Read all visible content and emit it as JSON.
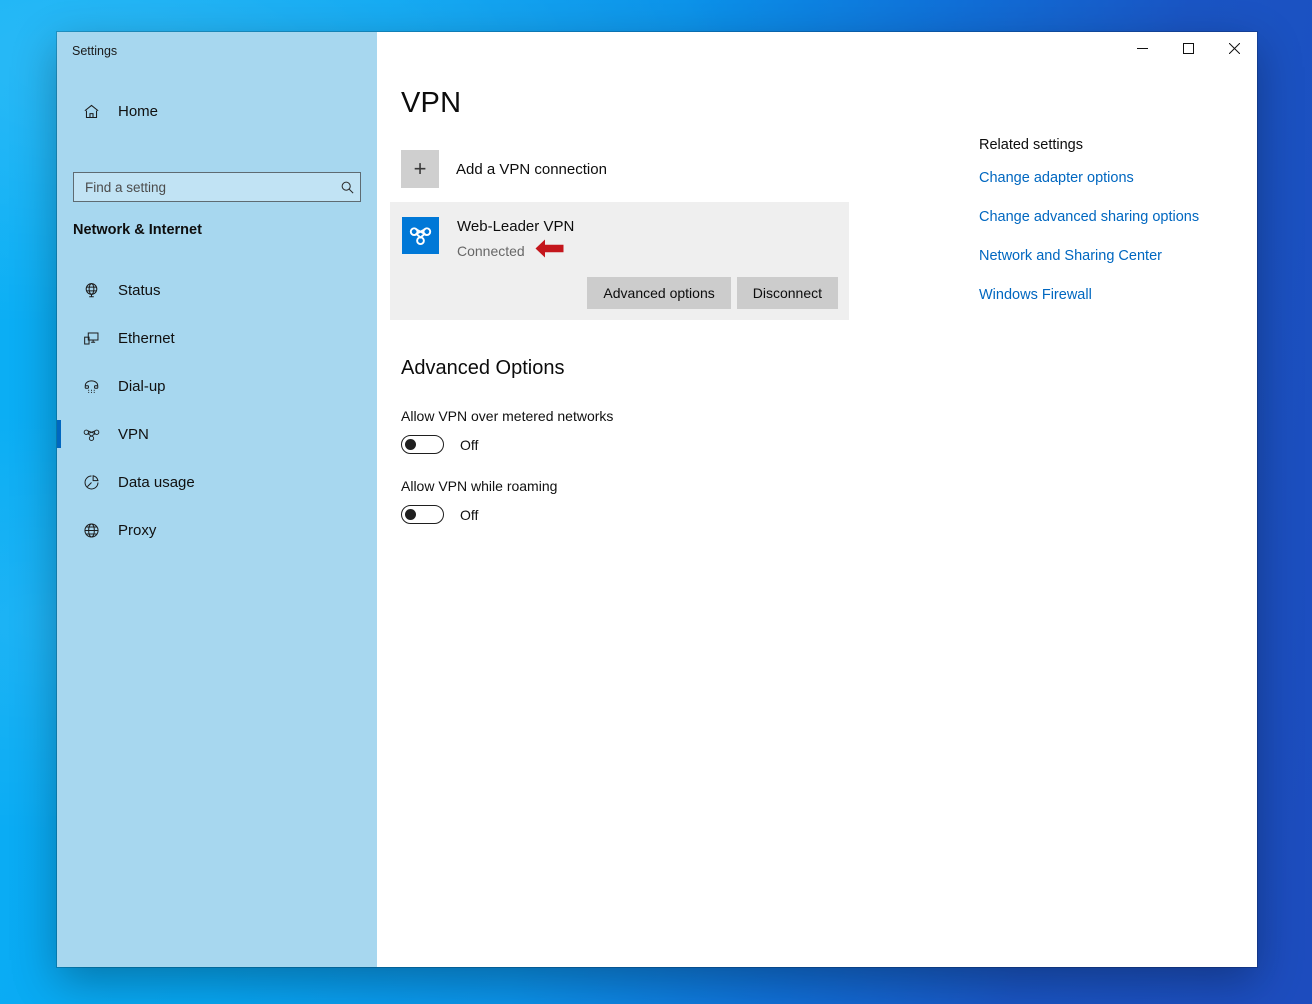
{
  "window": {
    "title": "Settings",
    "controls": {
      "minimize": "minimize-button",
      "maximize": "maximize-button",
      "close": "close-button"
    }
  },
  "sidebar": {
    "home_label": "Home",
    "search": {
      "placeholder": "Find a setting",
      "value": ""
    },
    "section_header": "Network & Internet",
    "items": [
      {
        "label": "Status",
        "icon": "globe-status-icon",
        "selected": false
      },
      {
        "label": "Ethernet",
        "icon": "ethernet-icon",
        "selected": false
      },
      {
        "label": "Dial-up",
        "icon": "dialup-phone-icon",
        "selected": false
      },
      {
        "label": "VPN",
        "icon": "vpn-icon",
        "selected": true
      },
      {
        "label": "Data usage",
        "icon": "pie-chart-icon",
        "selected": false
      },
      {
        "label": "Proxy",
        "icon": "globe-proxy-icon",
        "selected": false
      }
    ],
    "selected_index": 3
  },
  "main": {
    "page_title": "VPN",
    "add_connection": {
      "label": "Add a VPN connection",
      "icon": "plus-icon"
    },
    "connection": {
      "name": "Web-Leader VPN",
      "status": "Connected",
      "icon": "vpn-connection-icon",
      "buttons": [
        {
          "label": "Advanced options",
          "name": "advanced-options-button"
        },
        {
          "label": "Disconnect",
          "name": "disconnect-button"
        }
      ]
    },
    "annotation": {
      "type": "arrow-left",
      "color": "#c4161c",
      "points_at": "Connected"
    },
    "advanced": {
      "title": "Advanced Options",
      "options": [
        {
          "label": "Allow VPN over metered networks",
          "state": "Off",
          "on": false
        },
        {
          "label": "Allow VPN while roaming",
          "state": "Off",
          "on": false
        }
      ]
    }
  },
  "related": {
    "title": "Related settings",
    "links": [
      "Change adapter options",
      "Change advanced sharing options",
      "Network and Sharing Center",
      "Windows Firewall"
    ]
  },
  "colors": {
    "accent": "#0078d7",
    "link": "#0067c0",
    "sidebar": "#a7d7ef",
    "card": "#efefef",
    "button": "#cccccc",
    "annotation": "#c4161c"
  }
}
